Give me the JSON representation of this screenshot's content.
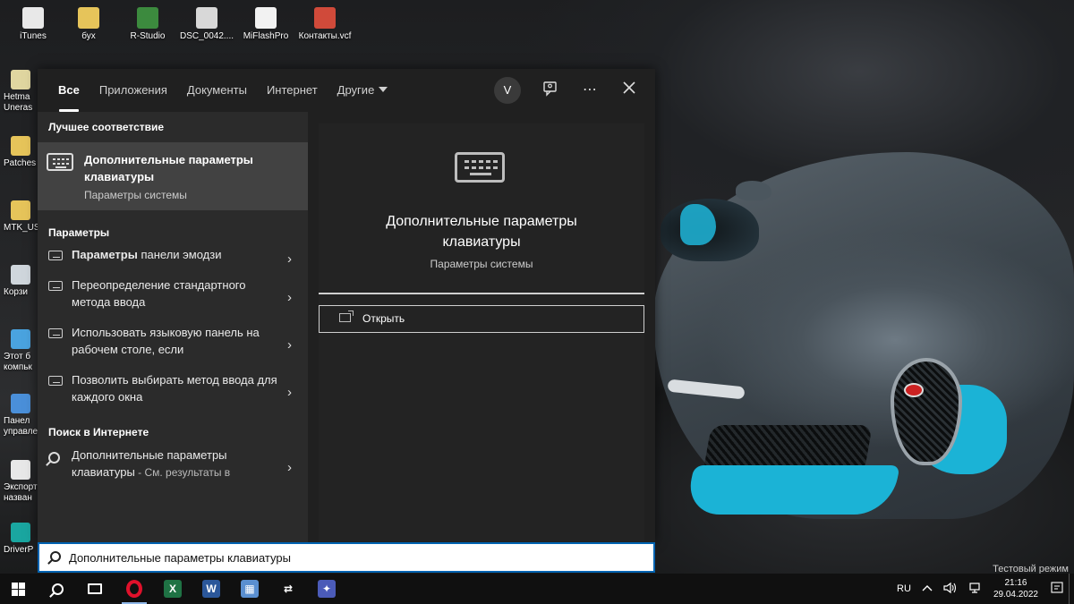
{
  "desktop": {
    "top_icons": [
      {
        "label": "iTunes",
        "icon": "itunes-icon",
        "color": "#e8e8e8"
      },
      {
        "label": "бух",
        "icon": "folder-icon",
        "color": "#e6c45a"
      },
      {
        "label": "R-Studio",
        "icon": "r-studio-icon",
        "color": "#3c8a3e"
      },
      {
        "label": "DSC_0042....",
        "icon": "video-file-icon",
        "color": "#d8d8d8"
      },
      {
        "label": "MiFlashPro",
        "icon": "miflash-icon",
        "color": "#f2f2f2"
      },
      {
        "label": "Контакты.vcf",
        "icon": "contact-card-icon",
        "color": "#d04a3a"
      }
    ],
    "left_icons": [
      {
        "line1": "Hetma",
        "line2": "Uneras",
        "icon": "hetman-icon",
        "color": "#e0d6a0"
      },
      {
        "line1": "Patches",
        "line2": "",
        "icon": "folder-icon",
        "color": "#e6c45a"
      },
      {
        "line1": "MTK_US",
        "line2": "",
        "icon": "folder-icon",
        "color": "#e6c45a"
      },
      {
        "line1": "Корзи",
        "line2": "",
        "icon": "recycle-bin-icon",
        "color": "#cfd6dc"
      },
      {
        "line1": "Этот б",
        "line2": "компьк",
        "icon": "this-pc-icon",
        "color": "#4aa3df"
      },
      {
        "line1": "Панел",
        "line2": "управле",
        "icon": "control-panel-icon",
        "color": "#4a8fd9"
      },
      {
        "line1": "Экспорт",
        "line2": "назван",
        "icon": "document-icon",
        "color": "#e8e8e8"
      },
      {
        "line1": "DriverP",
        "line2": "",
        "icon": "driverpack-icon",
        "color": "#1aa6a0"
      }
    ],
    "test_mode": "Тестовый режим"
  },
  "search": {
    "tabs": [
      {
        "label": "Все",
        "active": true
      },
      {
        "label": "Приложения",
        "active": false
      },
      {
        "label": "Документы",
        "active": false
      },
      {
        "label": "Интернет",
        "active": false
      },
      {
        "label": "Другие",
        "active": false
      }
    ],
    "avatar_letter": "V",
    "best_match_header": "Лучшее соответствие",
    "best_match": {
      "title": "Дополнительные параметры клавиатуры",
      "subtitle": "Параметры системы"
    },
    "settings_header": "Параметры",
    "settings_results": [
      {
        "bold": "Параметры",
        "rest": " панели эмодзи"
      },
      {
        "bold": "",
        "rest": "Переопределение стандартного метода ввода"
      },
      {
        "bold": "",
        "rest": "Использовать языковую панель на рабочем столе, если"
      },
      {
        "bold": "",
        "rest": "Позволить выбирать метод ввода для каждого окна"
      }
    ],
    "web_header": "Поиск в Интернете",
    "web_result": {
      "text": "Дополнительные параметры клавиатуры",
      "suffix": " - См. результаты в"
    },
    "preview": {
      "title": "Дополнительные параметры клавиатуры",
      "subtitle": "Параметры системы",
      "open_label": "Открыть"
    },
    "query": "Дополнительные параметры клавиатуры"
  },
  "taskbar": {
    "language": "RU",
    "time": "21:16",
    "date": "29.04.2022",
    "apps": [
      {
        "icon": "opera-icon",
        "color": "#e0112b",
        "active": true
      },
      {
        "icon": "excel-icon",
        "color": "#1f7244",
        "glyph": "X",
        "active": false
      },
      {
        "icon": "word-icon",
        "color": "#2b579a",
        "glyph": "W",
        "active": false
      },
      {
        "icon": "calculator-icon",
        "color": "#5a8fd0",
        "glyph": "▦",
        "active": false
      },
      {
        "icon": "shuffle-icon",
        "color": "#101010",
        "glyph": "⇄",
        "active": false
      },
      {
        "icon": "network-app-icon",
        "color": "#4b5bb8",
        "glyph": "✦",
        "active": false
      }
    ]
  }
}
